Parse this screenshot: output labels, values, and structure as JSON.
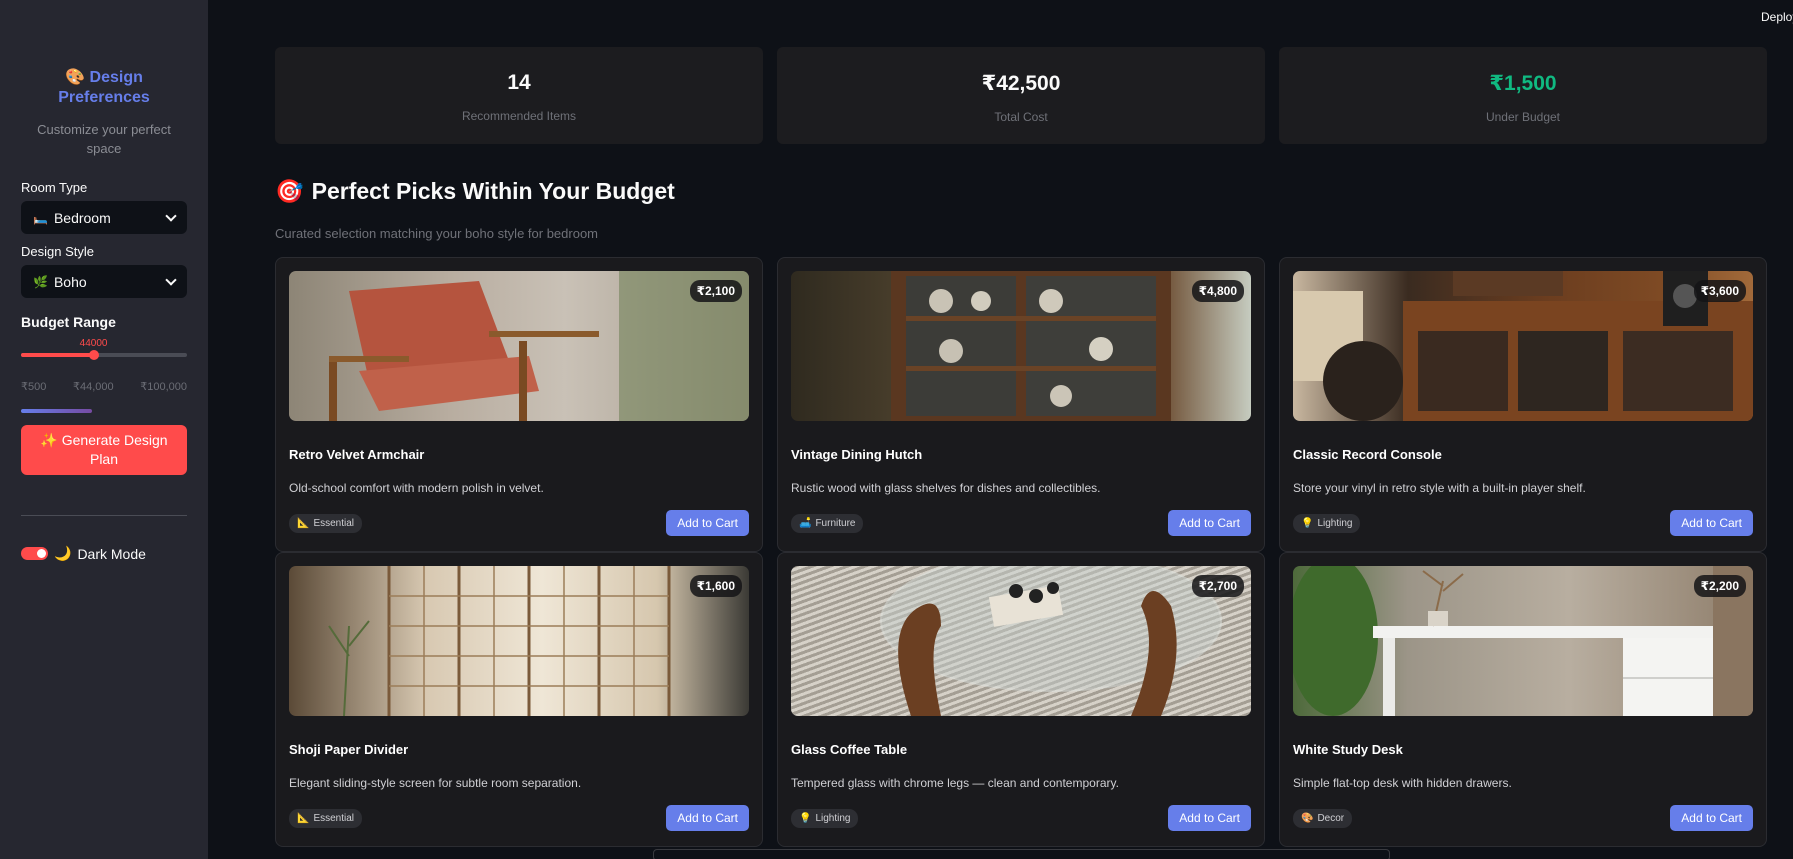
{
  "sidebar": {
    "title_emoji": "🎨",
    "title": "Design Preferences",
    "subtitle": "Customize your perfect space",
    "room_type": {
      "label": "Room Type",
      "emoji": "🛏️",
      "value": "Bedroom"
    },
    "design_style": {
      "label": "Design Style",
      "emoji": "🌿",
      "value": "Boho"
    },
    "budget": {
      "heading": "Budget Range",
      "current": "44000",
      "current_value": 44000,
      "min_value": 500,
      "max_value": 100000,
      "ticks": [
        "₹500",
        "₹44,000",
        "₹100,000"
      ]
    },
    "generate_button": "✨ Generate Design Plan",
    "dark_mode": {
      "emoji": "🌙",
      "label": "Dark Mode",
      "on": true
    }
  },
  "header": {
    "deploy": "Deploy"
  },
  "stats": [
    {
      "value": "14",
      "label": "Recommended Items",
      "color": "#fafafa"
    },
    {
      "value": "₹42,500",
      "label": "Total Cost",
      "color": "#fafafa"
    },
    {
      "value": "₹1,500",
      "label": "Under Budget",
      "color": "#10b981"
    }
  ],
  "section": {
    "emoji": "🎯",
    "title": "Perfect Picks Within Your Budget",
    "subtitle": "Curated selection matching your boho style for bedroom"
  },
  "products": [
    {
      "name": "Retro Velvet Armchair",
      "price": "₹2,100",
      "desc": "Old-school comfort with modern polish in velvet.",
      "tag_icon": "📐",
      "tag": "Essential",
      "button": "Add to Cart"
    },
    {
      "name": "Vintage Dining Hutch",
      "price": "₹4,800",
      "desc": "Rustic wood with glass shelves for dishes and collectibles.",
      "tag_icon": "🛋️",
      "tag": "Furniture",
      "button": "Add to Cart"
    },
    {
      "name": "Classic Record Console",
      "price": "₹3,600",
      "desc": "Store your vinyl in retro style with a built-in player shelf.",
      "tag_icon": "💡",
      "tag": "Lighting",
      "button": "Add to Cart"
    },
    {
      "name": "Shoji Paper Divider",
      "price": "₹1,600",
      "desc": "Elegant sliding-style screen for subtle room separation.",
      "tag_icon": "📐",
      "tag": "Essential",
      "button": "Add to Cart"
    },
    {
      "name": "Glass Coffee Table",
      "price": "₹2,700",
      "desc": "Tempered glass with chrome legs — clean and contemporary.",
      "tag_icon": "💡",
      "tag": "Lighting",
      "button": "Add to Cart"
    },
    {
      "name": "White Study Desk",
      "price": "₹2,200",
      "desc": "Simple flat-top desk with hidden drawers.",
      "tag_icon": "🎨",
      "tag": "Decor",
      "button": "Add to Cart"
    }
  ],
  "colors": {
    "accent": "#667eea",
    "primary_red": "#ff4b4b",
    "success": "#10b981",
    "background": "#0e1117",
    "sidebar": "#262730"
  }
}
